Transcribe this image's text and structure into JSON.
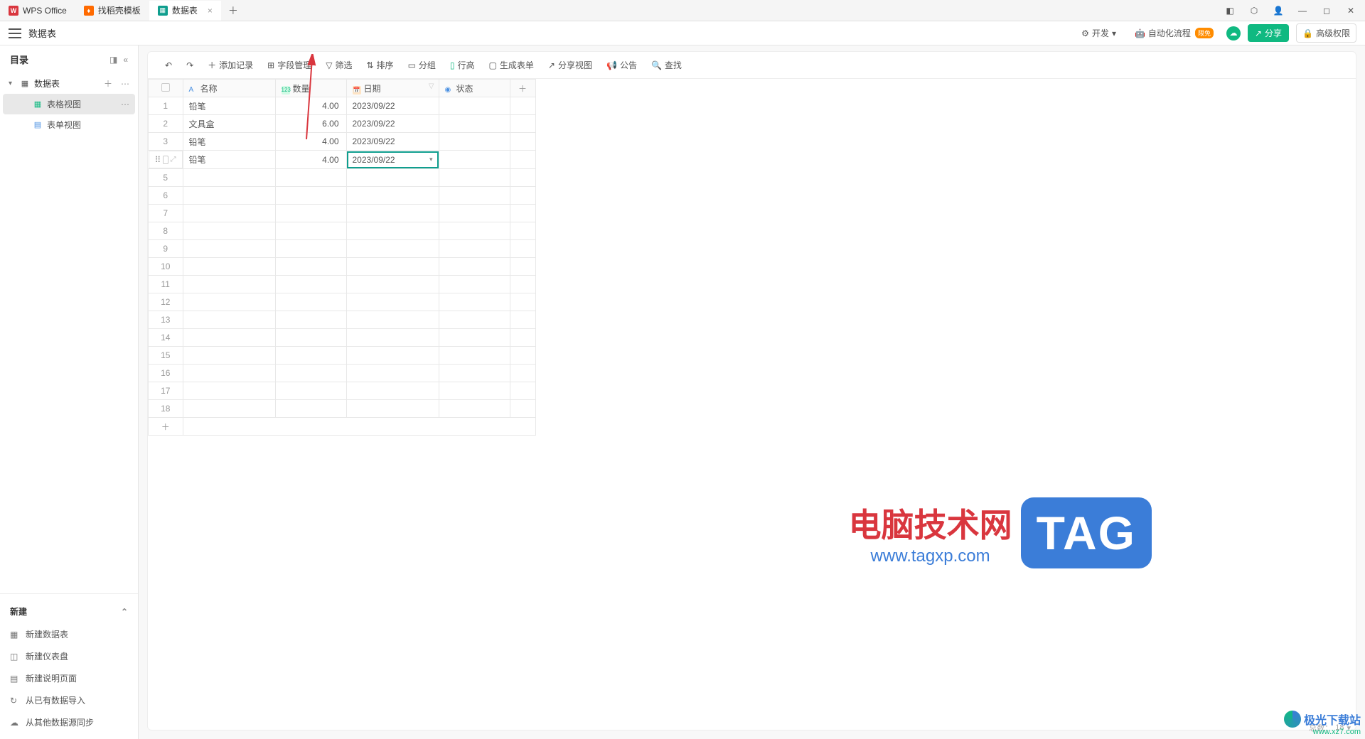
{
  "titlebar": {
    "tabs": [
      {
        "icon": "W",
        "label": "WPS Office"
      },
      {
        "icon": "♦",
        "label": "找稻壳模板"
      },
      {
        "icon": "▦",
        "label": "数据表",
        "active": true
      }
    ],
    "add": "＋"
  },
  "menubar": {
    "title": "数据表",
    "dev": "开发",
    "automation": "自动化流程",
    "automation_badge": "限免",
    "share": "分享",
    "permission": "高级权限"
  },
  "sidebar": {
    "catalog": "目录",
    "root": "数据表",
    "views": [
      {
        "icon": "table",
        "label": "表格视图",
        "active": true
      },
      {
        "icon": "form",
        "label": "表单视图"
      }
    ],
    "new_section": "新建",
    "new_items": [
      {
        "icon": "▦",
        "label": "新建数据表"
      },
      {
        "icon": "◫",
        "label": "新建仪表盘"
      },
      {
        "icon": "▤",
        "label": "新建说明页面"
      },
      {
        "icon": "↻",
        "label": "从已有数据导入"
      },
      {
        "icon": "☁",
        "label": "从其他数据源同步"
      }
    ]
  },
  "toolbar": {
    "undo": "↶",
    "redo": "↷",
    "add_record": "添加记录",
    "field_mgmt": "字段管理",
    "filter": "筛选",
    "sort": "排序",
    "group": "分组",
    "row_height": "行高",
    "gen_form": "生成表单",
    "share_view": "分享视图",
    "announce": "公告",
    "search": "查找"
  },
  "table": {
    "columns": {
      "name": "名称",
      "qty": "数量",
      "date": "日期",
      "status": "状态"
    },
    "rows": [
      {
        "n": "1",
        "name": "铅笔",
        "qty": "4.00",
        "date": "2023/09/22"
      },
      {
        "n": "2",
        "name": "文具盒",
        "qty": "6.00",
        "date": "2023/09/22"
      },
      {
        "n": "3",
        "name": "铅笔",
        "qty": "4.00",
        "date": "2023/09/22"
      },
      {
        "n": "4",
        "name": "铅笔",
        "qty": "4.00",
        "date": "2023/09/22",
        "active": true
      }
    ],
    "empty_rows": [
      "5",
      "6",
      "7",
      "8",
      "9",
      "10",
      "11",
      "12",
      "13",
      "14",
      "15",
      "16",
      "17",
      "18"
    ]
  },
  "footer": {
    "total_label": "总数：",
    "total": "18"
  },
  "watermark": {
    "t1": "电脑技术网",
    "t2": "www.tagxp.com",
    "box": "TAG",
    "corner_txt": "极光下载站",
    "corner_url": "www.xz7.com"
  }
}
